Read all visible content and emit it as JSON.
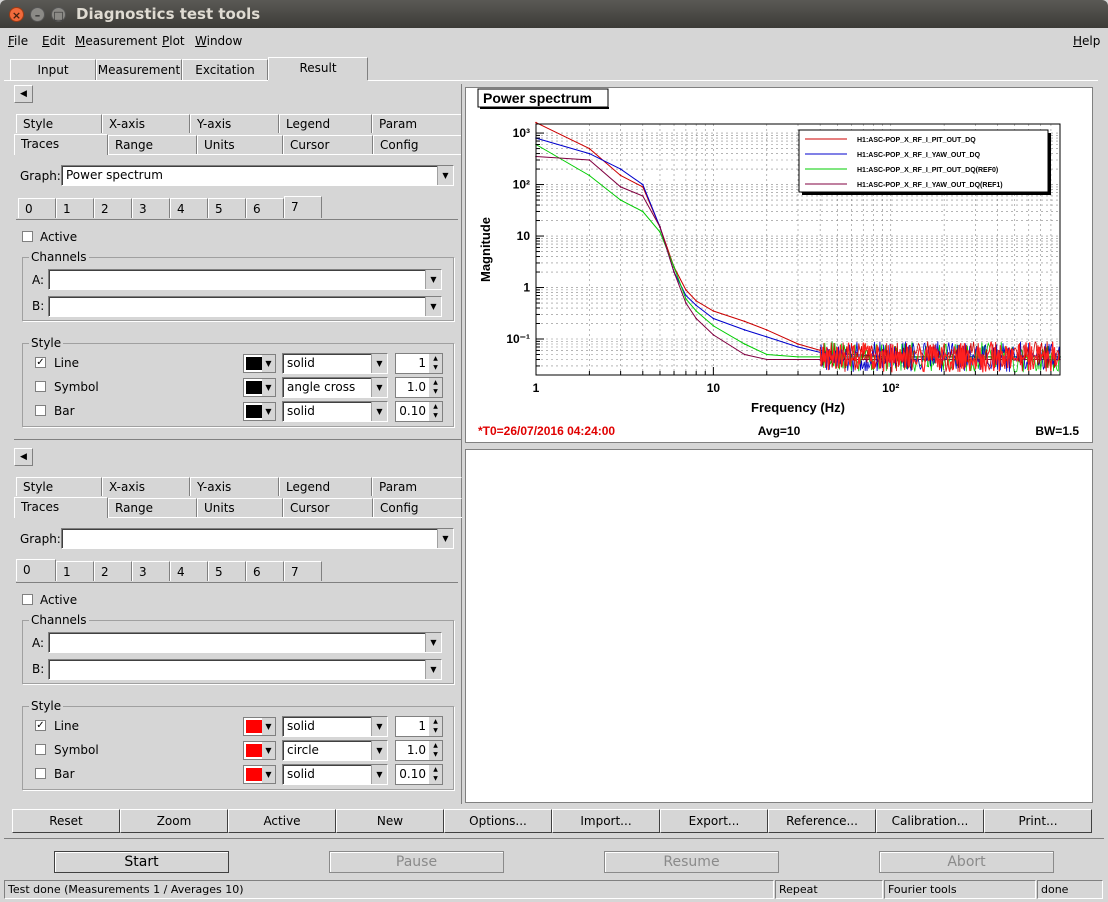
{
  "window": {
    "title": "Diagnostics test tools"
  },
  "menu": [
    "File",
    "Edit",
    "Measurement",
    "Plot",
    "Window"
  ],
  "menu_help": "Help",
  "main_tabs": [
    "Input",
    "Measurement",
    "Excitation",
    "Result"
  ],
  "panel_top": {
    "tabs_row1": [
      "Style",
      "X-axis",
      "Y-axis",
      "Legend",
      "Param"
    ],
    "tabs_row2": [
      "Traces",
      "Range",
      "Units",
      "Cursor",
      "Config"
    ],
    "graph_label": "Graph:",
    "graph_value": "Power spectrum",
    "trace_tabs": [
      "0",
      "1",
      "2",
      "3",
      "4",
      "5",
      "6",
      "7"
    ],
    "active_label": "Active",
    "channels_label": "Channels",
    "a_label": "A:",
    "b_label": "B:",
    "style_label": "Style",
    "rows": [
      {
        "label": "Line",
        "checked": true,
        "color": "#000000",
        "style": "solid",
        "value": "1"
      },
      {
        "label": "Symbol",
        "checked": false,
        "color": "#000000",
        "style": "angle cross",
        "value": "1.0"
      },
      {
        "label": "Bar",
        "checked": false,
        "color": "#000000",
        "style": "solid",
        "value": "0.10"
      }
    ]
  },
  "panel_bottom": {
    "tabs_row1": [
      "Style",
      "X-axis",
      "Y-axis",
      "Legend",
      "Param"
    ],
    "tabs_row2": [
      "Traces",
      "Range",
      "Units",
      "Cursor",
      "Config"
    ],
    "graph_label": "Graph:",
    "graph_value": "",
    "trace_tabs": [
      "0",
      "1",
      "2",
      "3",
      "4",
      "5",
      "6",
      "7"
    ],
    "active_label": "Active",
    "channels_label": "Channels",
    "a_label": "A:",
    "b_label": "B:",
    "style_label": "Style",
    "rows": [
      {
        "label": "Line",
        "checked": true,
        "color": "#ff0000",
        "style": "solid",
        "value": "1"
      },
      {
        "label": "Symbol",
        "checked": false,
        "color": "#ff0000",
        "style": "circle",
        "value": "1.0"
      },
      {
        "label": "Bar",
        "checked": false,
        "color": "#ff0000",
        "style": "solid",
        "value": "0.10"
      }
    ]
  },
  "check_mark": "✓",
  "toolbar": [
    "Reset",
    "Zoom",
    "Active",
    "New",
    "Options...",
    "Import...",
    "Export...",
    "Reference...",
    "Calibration...",
    "Print..."
  ],
  "control": {
    "start": "Start",
    "pause": "Pause",
    "resume": "Resume",
    "abort": "Abort"
  },
  "status": {
    "message": "Test done (Measurements 1 / Averages 10)",
    "mode": "Repeat",
    "tool": "Fourier tools",
    "state": "done"
  },
  "chart_data": {
    "type": "line",
    "title": "Power spectrum",
    "xlabel": "Frequency (Hz)",
    "ylabel": "Magnitude",
    "xscale": "log",
    "yscale": "log",
    "xlim": [
      1,
      900
    ],
    "ylim": [
      0.02,
      1500
    ],
    "x_ticks": [
      "1",
      "10",
      "10²"
    ],
    "y_ticks": [
      "10⁻¹",
      "1",
      "10",
      "10²",
      "10³"
    ],
    "grid": true,
    "legend_position": "top-right",
    "series": [
      {
        "name": "H1:ASC-POP_X_RF_I_PIT_OUT_DQ",
        "color": "#cc0000",
        "x": [
          1,
          2,
          3,
          4,
          5,
          6,
          7,
          8,
          10,
          15,
          20,
          30,
          40,
          60,
          100,
          200,
          500,
          900
        ],
        "values": [
          1600,
          500,
          150,
          90,
          15,
          2.5,
          0.9,
          0.55,
          0.35,
          0.22,
          0.15,
          0.08,
          0.06,
          0.05,
          0.045,
          0.045,
          0.045,
          0.045
        ]
      },
      {
        "name": "H1:ASC-POP_X_RF_I_YAW_OUT_DQ",
        "color": "#0000cc",
        "x": [
          1,
          2,
          3,
          4,
          5,
          6,
          7,
          8,
          10,
          15,
          20,
          30,
          40,
          60,
          100,
          200,
          500,
          900
        ],
        "values": [
          800,
          400,
          200,
          100,
          15,
          2.0,
          0.7,
          0.45,
          0.25,
          0.15,
          0.11,
          0.07,
          0.055,
          0.05,
          0.045,
          0.045,
          0.045,
          0.045
        ]
      },
      {
        "name": "H1:ASC-POP_X_RF_I_PIT_OUT_DQ(REF0)",
        "color": "#00cc00",
        "x": [
          1,
          2,
          3,
          4,
          5,
          6,
          7,
          8,
          10,
          15,
          20,
          30,
          40,
          60,
          100,
          200,
          500,
          900
        ],
        "values": [
          600,
          150,
          50,
          30,
          12,
          2.5,
          0.6,
          0.35,
          0.18,
          0.08,
          0.05,
          0.045,
          0.045,
          0.045,
          0.045,
          0.045,
          0.045,
          0.045
        ]
      },
      {
        "name": "H1:ASC-POP_X_RF_I_YAW_OUT_DQ(REF1)",
        "color": "#800040",
        "x": [
          1,
          2,
          3,
          4,
          5,
          6,
          7,
          8,
          10,
          15,
          20,
          30,
          40,
          60,
          100,
          200,
          500,
          900
        ],
        "values": [
          350,
          300,
          90,
          60,
          15,
          2.0,
          0.5,
          0.25,
          0.12,
          0.05,
          0.04,
          0.04,
          0.04,
          0.04,
          0.04,
          0.04,
          0.04,
          0.04
        ]
      }
    ],
    "annotations": {
      "t0": "*T0=26/07/2016 04:24:00",
      "avg": "Avg=10",
      "bw": "BW=1.5"
    }
  }
}
